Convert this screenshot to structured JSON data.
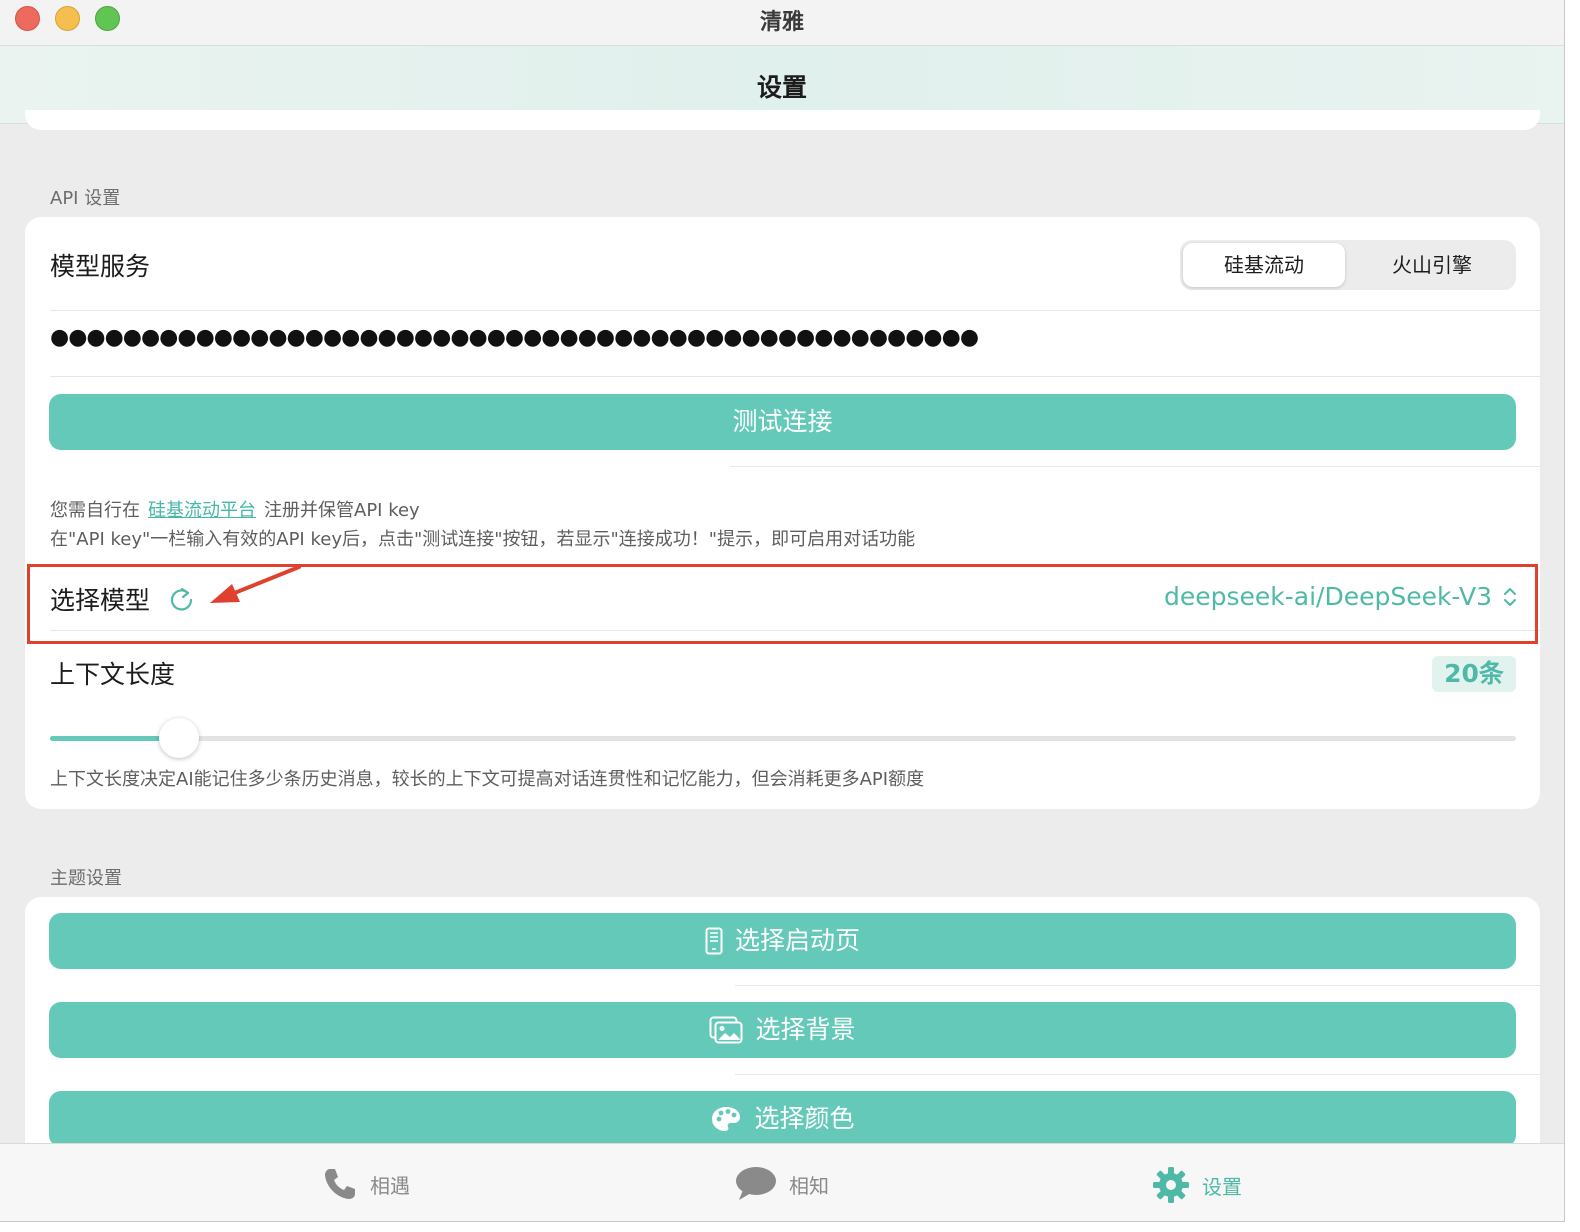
{
  "window": {
    "title": "清雅"
  },
  "nav": {
    "title": "设置"
  },
  "api_section": {
    "label": "API 设置",
    "model_service": {
      "title": "模型服务",
      "options": [
        "硅基流动",
        "火山引擎"
      ],
      "selected": "硅基流动"
    },
    "api_key_masked": "●●●●●●●●●●●●●●●●●●●●●●●●●●●●●●●●●●●●●●●●●●●●●●●●●●●",
    "test_button": "测试连接",
    "hint": {
      "prefix": "您需自行在",
      "link": "硅基流动平台",
      "suffix": "注册并保管API key",
      "line2": "在\"API key\"一栏输入有效的API key后，点击\"测试连接\"按钮，若显示\"连接成功！\"提示，即可启用对话功能"
    },
    "model_select": {
      "title": "选择模型",
      "value": "deepseek-ai/DeepSeek-V3"
    },
    "context": {
      "title": "上下文长度",
      "badge": "20条",
      "slider_fraction": 0.088,
      "description": "上下文长度决定AI能记住多少条历史消息，较长的上下文可提高对话连贯性和记忆能力，但会消耗更多API额度"
    }
  },
  "theme_section": {
    "label": "主题设置",
    "buttons": {
      "splash": "选择启动页",
      "background": "选择背景",
      "color": "选择颜色"
    }
  },
  "tabbar": {
    "items": [
      {
        "label": "相遇",
        "icon": "phone-icon"
      },
      {
        "label": "相知",
        "icon": "chat-bubble-icon"
      },
      {
        "label": "设置",
        "icon": "gear-icon"
      }
    ],
    "active": "设置"
  },
  "colors": {
    "accent": "#64c9b9",
    "accent_text": "#4fb9a8",
    "highlight": "#e0412f"
  }
}
